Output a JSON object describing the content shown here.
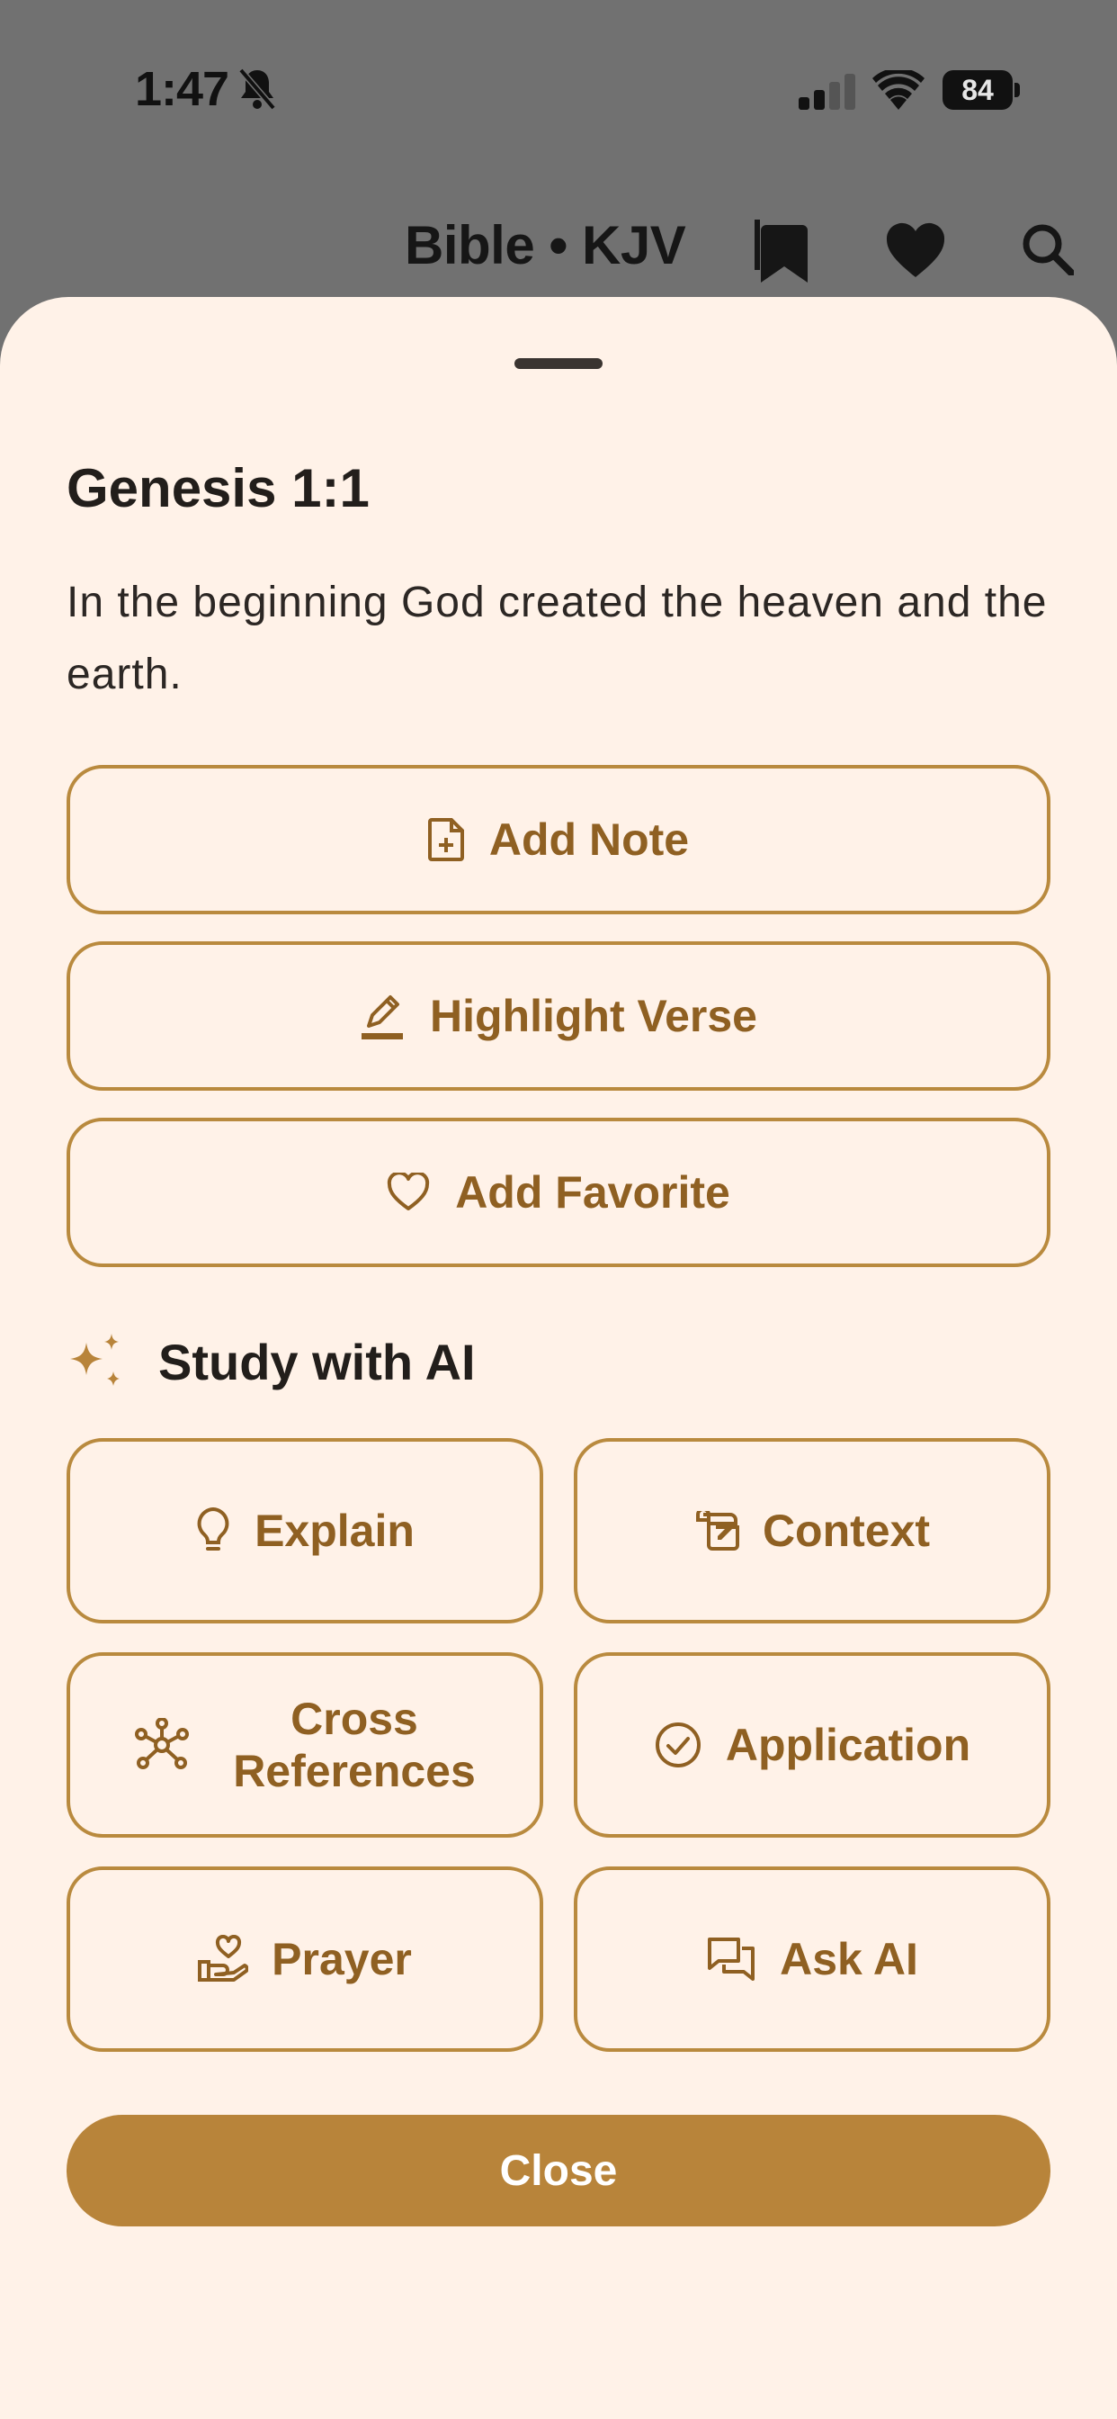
{
  "status_bar": {
    "time": "1:47",
    "battery": "84"
  },
  "nav": {
    "title": "Bible • KJV"
  },
  "sheet": {
    "verse_reference": "Genesis 1:1",
    "verse_text": "In the beginning God created the heaven and the earth.",
    "actions": [
      {
        "label": "Add Note",
        "icon": "note-add-icon"
      },
      {
        "label": "Highlight Verse",
        "icon": "pencil-highlight-icon"
      },
      {
        "label": "Add Favorite",
        "icon": "heart-outline-icon"
      }
    ],
    "ai_section": {
      "title": "Study with AI",
      "icon": "sparkles-icon",
      "buttons": [
        {
          "label": "Explain",
          "icon": "lightbulb-icon"
        },
        {
          "label": "Context",
          "icon": "scroll-icon"
        },
        {
          "label_line1": "Cross",
          "label_line2": "References",
          "icon": "network-icon"
        },
        {
          "label": "Application",
          "icon": "check-circle-icon"
        },
        {
          "label": "Prayer",
          "icon": "hand-heart-icon"
        },
        {
          "label": "Ask AI",
          "icon": "chat-bubbles-icon"
        }
      ]
    },
    "close_label": "Close"
  },
  "colors": {
    "accent": "#b8843a",
    "accent_text": "#8f6022",
    "sheet_bg": "#fff2e8",
    "backdrop": "#717171"
  }
}
